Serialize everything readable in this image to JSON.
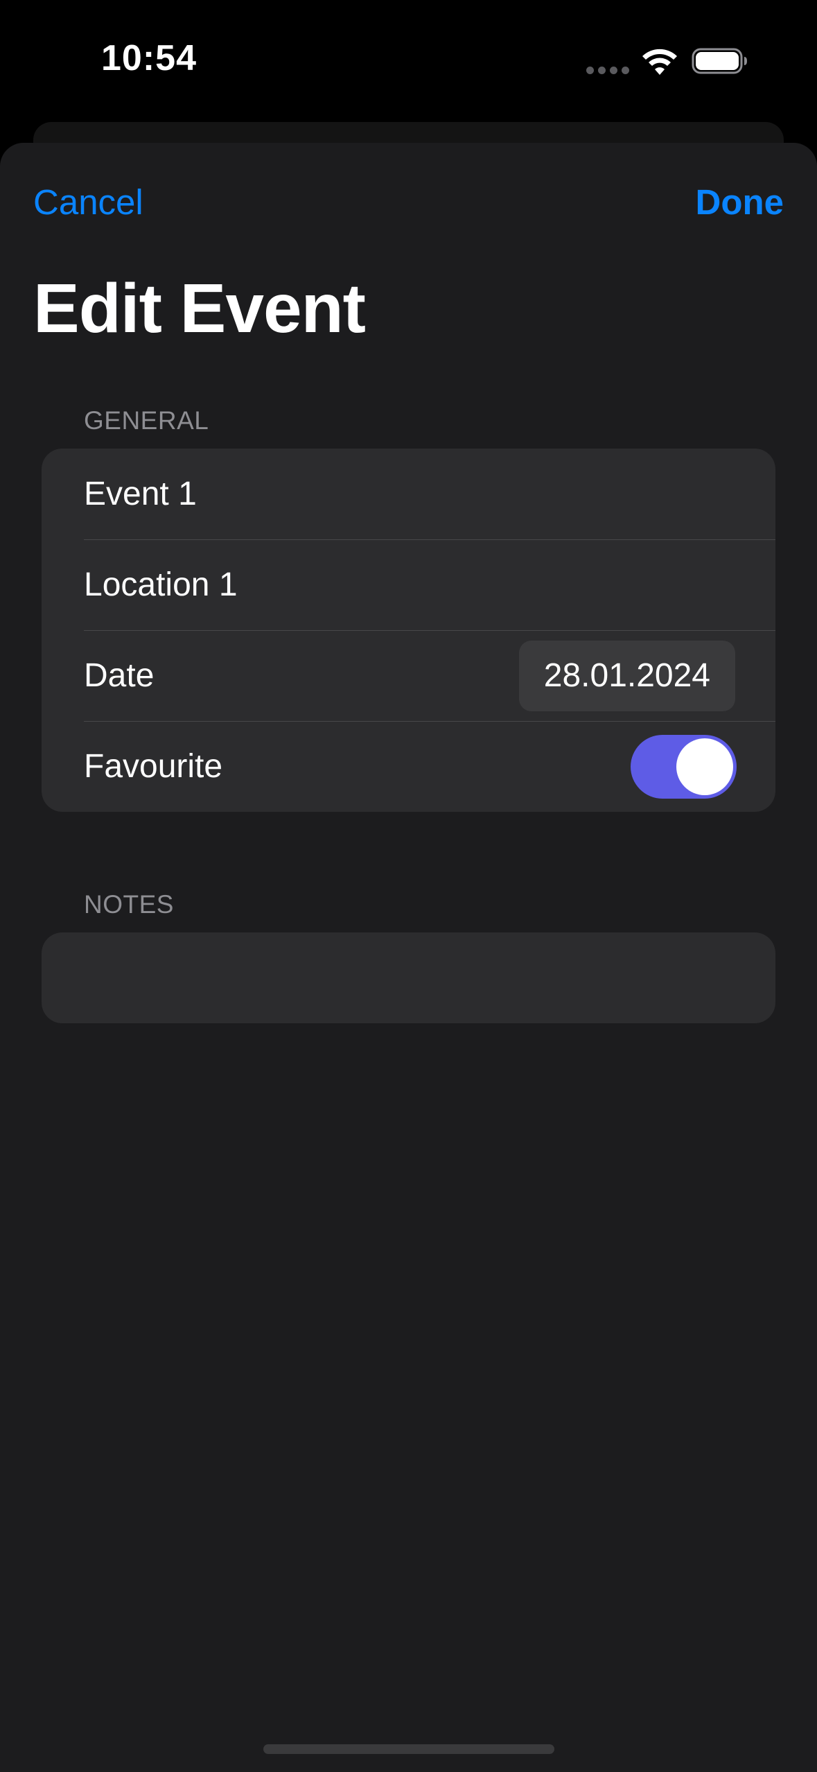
{
  "status_bar": {
    "time": "10:54",
    "icons": [
      "cellular-signal-icon",
      "wifi-icon",
      "battery-icon"
    ]
  },
  "nav": {
    "cancel_label": "Cancel",
    "done_label": "Done"
  },
  "title": "Edit Event",
  "general": {
    "header": "GENERAL",
    "name_value": "Event 1",
    "location_value": "Location 1",
    "date_label": "Date",
    "date_value": "28.01.2024",
    "favourite_label": "Favourite",
    "favourite_on": true
  },
  "notes": {
    "header": "NOTES",
    "value": ""
  },
  "colors": {
    "accent": "#0a84ff",
    "toggle_on": "#5e5ce6",
    "sheet_bg": "#1c1c1e",
    "group_bg": "#2c2c2e"
  }
}
